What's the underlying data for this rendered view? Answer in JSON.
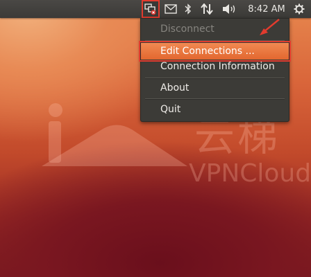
{
  "panel": {
    "clock": "8:42 AM",
    "indicators": [
      {
        "icon": "network-disconnected-icon"
      },
      {
        "icon": "mail-icon"
      },
      {
        "icon": "bluetooth-icon"
      },
      {
        "icon": "transfer-arrows-icon"
      },
      {
        "icon": "volume-icon"
      },
      {
        "icon": "gear-icon"
      }
    ]
  },
  "menu": {
    "items": [
      {
        "label": "Disconnect",
        "enabled": false
      },
      {
        "label": "Edit Connections ...",
        "enabled": true,
        "highlighted": true
      },
      {
        "label": "Connection Information",
        "enabled": true
      },
      {
        "label": "About",
        "enabled": true
      },
      {
        "label": "Quit",
        "enabled": true
      }
    ]
  },
  "watermark": {
    "chinese": "云梯",
    "english": "VPNCloud"
  },
  "colors": {
    "highlight": "#e8713a",
    "annotation_red": "#e23b2e",
    "panel": "#3c3b37"
  }
}
